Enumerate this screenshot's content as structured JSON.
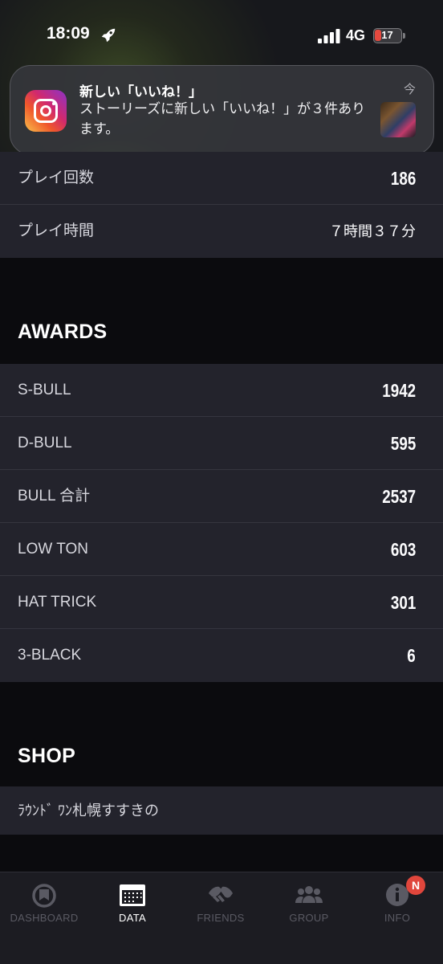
{
  "status_bar": {
    "time": "18:09",
    "network": "4G",
    "battery": "17"
  },
  "notification": {
    "app_icon": "instagram-icon",
    "title": "新しい「いいね！」",
    "body": "ストーリーズに新しい「いいね！」が３件あります。",
    "time": "今"
  },
  "stats": [
    {
      "label": "プレイ回数",
      "value": "186"
    },
    {
      "label": "プレイ時間",
      "value": "７時間３７分"
    }
  ],
  "awards": {
    "title": "AWARDS",
    "items": [
      {
        "label": "S-BULL",
        "value": "1942"
      },
      {
        "label": "D-BULL",
        "value": "595"
      },
      {
        "label": "BULL 合計",
        "value": "2537"
      },
      {
        "label": "LOW TON",
        "value": "603"
      },
      {
        "label": "HAT TRICK",
        "value": "301"
      },
      {
        "label": "3-BLACK",
        "value": "6"
      }
    ]
  },
  "shop": {
    "title": "SHOP",
    "name": "ﾗｳﾝﾄﾞ ﾜﾝ札幌すすきの"
  },
  "tab_bar": {
    "tabs": [
      {
        "label": "DASHBOARD",
        "icon": "dashboard-icon",
        "active": false
      },
      {
        "label": "DATA",
        "icon": "calendar-icon",
        "active": true
      },
      {
        "label": "FRIENDS",
        "icon": "friends-icon",
        "active": false
      },
      {
        "label": "GROUP",
        "icon": "group-icon",
        "active": false
      },
      {
        "label": "INFO",
        "icon": "info-icon",
        "active": false
      }
    ],
    "info_badge": "N"
  },
  "colors": {
    "background": "#0b0b0e",
    "panel": "#23232c",
    "badge": "#e0463c",
    "active_tab": "#ffffff",
    "inactive_tab": "#5a5a63"
  }
}
